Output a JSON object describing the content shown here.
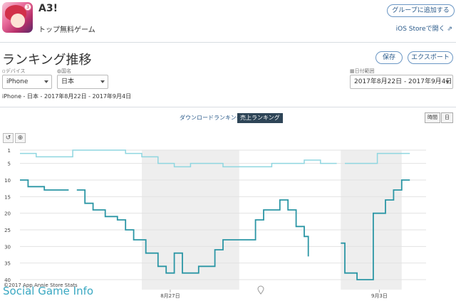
{
  "app": {
    "title": "A3!",
    "category": "トップ無料",
    "subcategory": "ゲーム"
  },
  "header": {
    "group_button": "グループに追加する",
    "ios_store_link": "iOS Storeで開く"
  },
  "page": {
    "title": "ランキング推移",
    "save_button": "保存",
    "export_button": "エクスポート"
  },
  "filters": {
    "device_label": "デバイス",
    "device_value": "iPhone",
    "country_label": "国名",
    "country_value": "日本",
    "date_label": "日付範囲",
    "date_value": "2017年8月22日 - 2017年9月4日"
  },
  "subtitle": "iPhone - 日本 - 2017年8月22日 - 2017年9月4日",
  "tabs": {
    "downloads": "ダウンロードランキング",
    "revenue": "売上ランキング"
  },
  "granularity": {
    "hourly": "時間",
    "daily": "日"
  },
  "watermarks": {
    "copyright": "©2017 App Annie Store Stats",
    "brand": "Social Game Info"
  },
  "colors": {
    "accent": "#2a5a8a",
    "series_light": "#8fd6e0",
    "series_dark": "#2b96a5",
    "shade": "#eeeeee"
  },
  "chart_data": {
    "type": "line",
    "y_ticks": [
      "1",
      "5",
      "10",
      "15",
      "20",
      "25",
      "30",
      "35",
      "40"
    ],
    "x_ticks": [
      "8月27日",
      "9月3日"
    ],
    "ylim": [
      1,
      43
    ],
    "y_inverted": true,
    "shaded_x_ranges": [
      [
        0.3,
        0.54
      ],
      [
        0.79,
        0.94
      ]
    ],
    "series": [
      {
        "values": [
          [
            0,
            2
          ],
          [
            0.04,
            3
          ],
          [
            0.08,
            3
          ],
          [
            0.12,
            3
          ],
          [
            0.13,
            1
          ],
          [
            0.2,
            1
          ],
          [
            0.24,
            1
          ],
          [
            0.26,
            2
          ],
          [
            0.3,
            3
          ],
          [
            0.34,
            5
          ],
          [
            0.38,
            6
          ],
          [
            0.42,
            5
          ],
          [
            0.46,
            5
          ],
          [
            0.5,
            6
          ],
          [
            0.54,
            6
          ],
          [
            0.58,
            6
          ],
          [
            0.62,
            5
          ],
          [
            0.66,
            5
          ],
          [
            0.7,
            4
          ],
          [
            0.74,
            5
          ],
          [
            0.78,
            5
          ],
          [
            0.79,
            null
          ],
          [
            0.8,
            5
          ],
          [
            0.86,
            5
          ],
          [
            0.88,
            2
          ],
          [
            0.96,
            2
          ]
        ]
      },
      {
        "values": [
          [
            0,
            10
          ],
          [
            0.02,
            12
          ],
          [
            0.06,
            13
          ],
          [
            0.12,
            13
          ],
          [
            0.13,
            null
          ],
          [
            0.14,
            13
          ],
          [
            0.16,
            17
          ],
          [
            0.18,
            19
          ],
          [
            0.21,
            21
          ],
          [
            0.24,
            22
          ],
          [
            0.26,
            25
          ],
          [
            0.28,
            28
          ],
          [
            0.31,
            32
          ],
          [
            0.34,
            36
          ],
          [
            0.36,
            38
          ],
          [
            0.38,
            32
          ],
          [
            0.4,
            38
          ],
          [
            0.44,
            36
          ],
          [
            0.48,
            31
          ],
          [
            0.5,
            28
          ],
          [
            0.54,
            28
          ],
          [
            0.58,
            22
          ],
          [
            0.6,
            19
          ],
          [
            0.64,
            16
          ],
          [
            0.66,
            19
          ],
          [
            0.68,
            24
          ],
          [
            0.7,
            27
          ],
          [
            0.71,
            33
          ],
          [
            0.72,
            null
          ],
          [
            0.79,
            29
          ],
          [
            0.8,
            38
          ],
          [
            0.83,
            40
          ],
          [
            0.86,
            40
          ],
          [
            0.87,
            20
          ],
          [
            0.9,
            16
          ],
          [
            0.92,
            13
          ],
          [
            0.94,
            10
          ],
          [
            0.96,
            10
          ]
        ]
      }
    ]
  }
}
